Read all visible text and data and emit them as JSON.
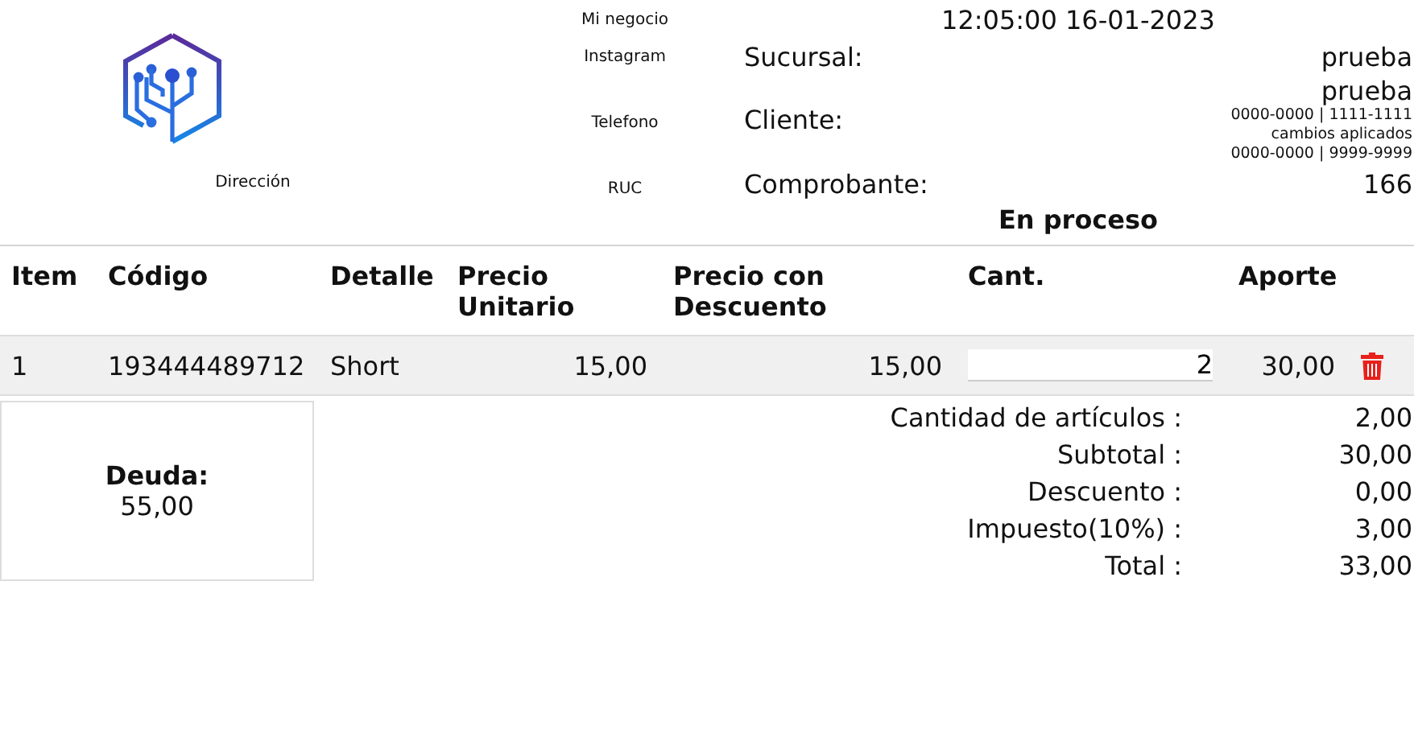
{
  "business": {
    "name": "Mi negocio",
    "instagram": "Instagram",
    "phone": "Telefono",
    "address": "Dirección",
    "ruc": "RUC"
  },
  "datetime": "12:05:00 16-01-2023",
  "info": {
    "branch_label": "Sucursal:",
    "branch": "prueba",
    "client_label": "Cliente:",
    "client": "prueba",
    "client_details": [
      "0000-0000 | 1111-1111",
      "cambios aplicados",
      "0000-0000 | 9999-9999"
    ],
    "voucher_label": "Comprobante:",
    "voucher": "166"
  },
  "status": "En proceso",
  "table": {
    "columns": [
      "Item",
      "Código",
      "Detalle",
      "Precio Unitario",
      "Precio con Descuento",
      "Cant.",
      "Aporte"
    ],
    "rows": [
      {
        "item": "1",
        "code": "193444489712",
        "detail": "Short",
        "unit_price": "15,00",
        "discount_price": "15,00",
        "quantity": "2",
        "amount": "30,00"
      }
    ]
  },
  "debt": {
    "label": "Deuda:",
    "value": "55,00"
  },
  "totals": [
    {
      "label": "Cantidad de artículos :",
      "value": "2,00"
    },
    {
      "label": "Subtotal :",
      "value": "30,00"
    },
    {
      "label": "Descuento :",
      "value": "0,00"
    },
    {
      "label": "Impuesto(10%) :",
      "value": "3,00"
    },
    {
      "label": "Total :",
      "value": "33,00"
    }
  ]
}
